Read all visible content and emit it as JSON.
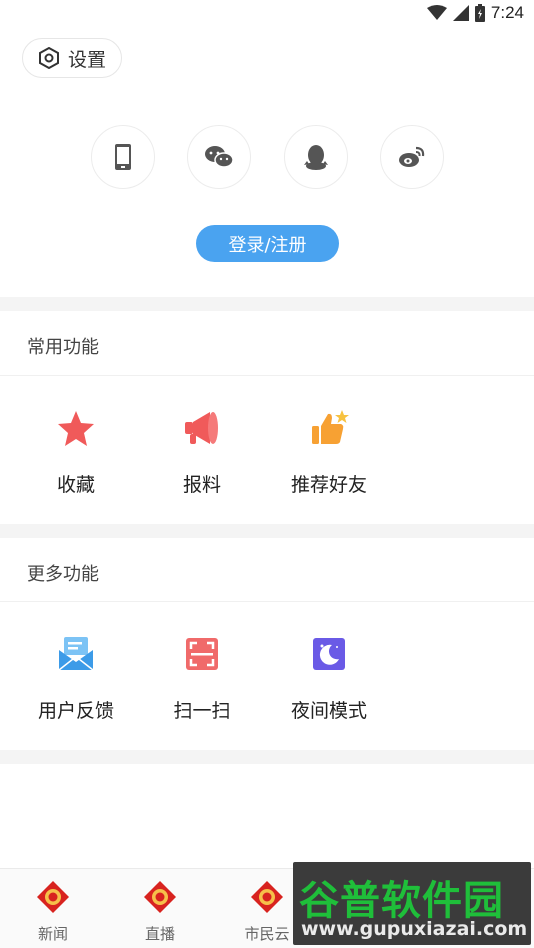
{
  "status_bar": {
    "time": "7:24"
  },
  "settings": {
    "label": "设置"
  },
  "login": {
    "methods": [
      {
        "name": "phone-icon"
      },
      {
        "name": "wechat-icon"
      },
      {
        "name": "qq-icon"
      },
      {
        "name": "weibo-icon"
      }
    ],
    "button_label": "登录/注册",
    "accent_color": "#4aa3f0"
  },
  "common_functions": {
    "title": "常用功能",
    "items": [
      {
        "label": "收藏",
        "icon": "star-icon"
      },
      {
        "label": "报料",
        "icon": "megaphone-icon"
      },
      {
        "label": "推荐好友",
        "icon": "thumbs-up-icon"
      }
    ]
  },
  "more_functions": {
    "title": "更多功能",
    "items": [
      {
        "label": "用户反馈",
        "icon": "mail-icon"
      },
      {
        "label": "扫一扫",
        "icon": "scan-icon"
      },
      {
        "label": "夜间模式",
        "icon": "moon-icon"
      }
    ]
  },
  "bottom_nav": {
    "items": [
      {
        "label": "新闻"
      },
      {
        "label": "直播"
      },
      {
        "label": "市民云"
      }
    ]
  },
  "watermark": {
    "title": "谷普软件园",
    "url": "www.gupuxiazai.com"
  }
}
